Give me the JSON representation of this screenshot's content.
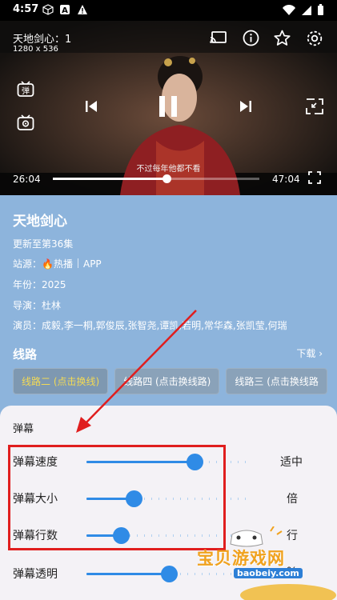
{
  "status_bar": {
    "time": "4:57"
  },
  "player": {
    "title": "天地剑心：1",
    "resolution": "1280 x 536",
    "subtitle": "不过每年他都不看",
    "current_time": "26:04",
    "total_time": "47:04",
    "progress": 0.55,
    "danmaku_button": "弹"
  },
  "info": {
    "title": "天地剑心",
    "update": "更新至第36集",
    "source_label": "站源：",
    "source_hot": "热播",
    "source_app": "APP",
    "year": "年份：2025",
    "director": "导演：杜林",
    "cast": "演员：成毅,李一桐,郭俊辰,张智尧,谭凯,若明,常华森,张凯莹,何瑞"
  },
  "routes": {
    "title": "线路",
    "download": "下载",
    "items": [
      {
        "label": "线路二 (点击换线)",
        "active": true
      },
      {
        "label": "线路四 (点击换线路)",
        "active": false
      },
      {
        "label": "线路三 (点击换线路",
        "active": false
      }
    ]
  },
  "danmaku_settings": {
    "title": "弹幕",
    "rows": [
      {
        "label": "弹幕速度",
        "value": "适中",
        "level": 0.66
      },
      {
        "label": "弹幕大小",
        "value": "倍",
        "level": 0.29
      },
      {
        "label": "弹幕行数",
        "value": "行",
        "level": 0.21
      },
      {
        "label": "弹幕透明",
        "value": "%",
        "level": 0.5
      }
    ]
  },
  "watermark": {
    "text": "宝贝游戏网",
    "url": "baobeiy.com"
  },
  "colors": {
    "accent": "#2f8be6",
    "highlight": "#e01e1e",
    "active_route": "#f3da55",
    "background": "#8db4dc"
  }
}
